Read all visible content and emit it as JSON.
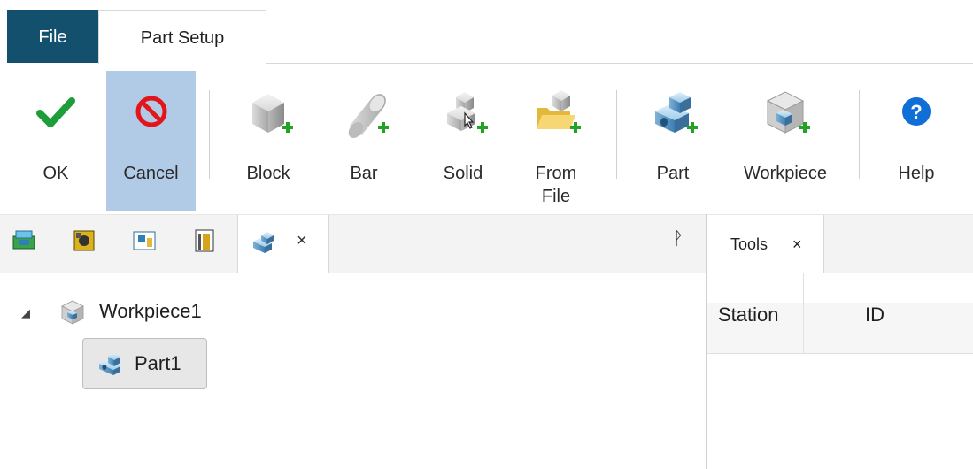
{
  "tabs": {
    "file": "File",
    "part_setup": "Part Setup"
  },
  "ribbon": {
    "ok": "OK",
    "cancel": "Cancel",
    "block": "Block",
    "bar": "Bar",
    "solid": "Solid",
    "from_file": "From\nFile",
    "part": "Part",
    "workpiece": "Workpiece",
    "help": "Help"
  },
  "left_pane": {
    "close_glyph": "×",
    "pin_glyph": "ᚹ",
    "tree": {
      "expander": "◢",
      "workpiece": "Workpiece1",
      "part": "Part1"
    }
  },
  "right_pane": {
    "tab": "Tools",
    "close_glyph": "×",
    "columns": [
      "Station",
      "ID"
    ]
  },
  "colors": {
    "file_tab": "#13506e",
    "pressed": "#b1cbe6",
    "ok_check": "#1e9e3a",
    "cancel_red": "#e3151a",
    "help_blue": "#0f6fd6",
    "plus_green": "#23a323"
  }
}
